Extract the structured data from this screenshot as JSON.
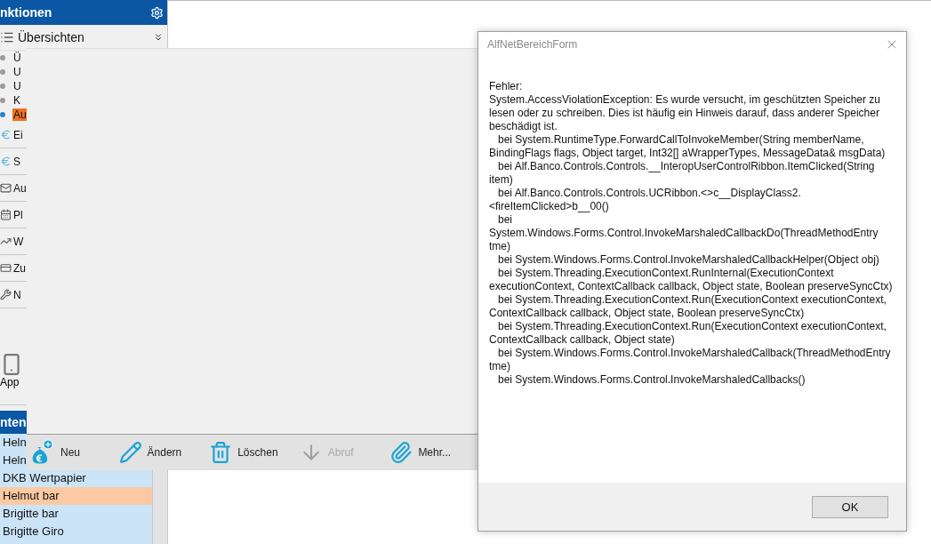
{
  "sidebar": {
    "header": {
      "title": "nktionen"
    },
    "section": {
      "title": "Übersichten"
    },
    "sub_items": [
      {
        "label": "Ü",
        "selected": false
      },
      {
        "label": "U",
        "selected": false
      },
      {
        "label": "U",
        "selected": false
      },
      {
        "label": "K",
        "selected": false
      },
      {
        "label": "Au",
        "selected": true
      }
    ],
    "items": [
      {
        "label": "Ei"
      },
      {
        "label": "S"
      },
      {
        "label": "Au"
      },
      {
        "label": "Pl"
      },
      {
        "label": "W"
      },
      {
        "label": "Zu"
      },
      {
        "label": "N"
      }
    ],
    "app_tile": {
      "label": "App"
    },
    "accounts": {
      "title": "nten",
      "rows": [
        {
          "name": "Heln",
          "selected": false
        },
        {
          "name": "Heln",
          "selected": false
        },
        {
          "name": "DKB Wertpapier",
          "selected": false
        },
        {
          "name": "Helmut bar",
          "selected": true
        },
        {
          "name": "Brigitte bar",
          "selected": false
        },
        {
          "name": "Brigitte Giro",
          "selected": false
        }
      ]
    }
  },
  "toolbar": {
    "buttons": [
      {
        "label": "Neu",
        "disabled": false
      },
      {
        "label": "Ändern",
        "disabled": false
      },
      {
        "label": "Löschen",
        "disabled": false
      },
      {
        "label": "Abruf",
        "disabled": true
      },
      {
        "label": "Mehr...",
        "disabled": false
      }
    ]
  },
  "dialog": {
    "title": "AlfNetBereichForm",
    "heading": "Fehler:",
    "exception": "System.AccessViolationException: Es wurde versucht, im geschützten Speicher zu lesen oder zu schreiben. Dies ist häufig ein Hinweis darauf, dass anderer Speicher beschädigt ist.",
    "stack": [
      "bei System.RuntimeType.ForwardCallToInvokeMember(String memberName, BindingFlags flags, Object target, Int32[] aWrapperTypes, MessageData& msgData)",
      "bei Alf.Banco.Controls.Controls.__InteropUserControlRibbon.ItemClicked(String item)",
      "bei Alf.Banco.Controls.Controls.UCRibbon.<>c__DisplayClass2.<fireItemClicked>b__00()",
      "bei System.Windows.Forms.Control.InvokeMarshaledCallbackDo(ThreadMethodEntry tme)",
      "bei System.Windows.Forms.Control.InvokeMarshaledCallbackHelper(Object obj)",
      "bei System.Threading.ExecutionContext.RunInternal(ExecutionContext executionContext, ContextCallback callback, Object state, Boolean preserveSyncCtx)",
      "bei System.Threading.ExecutionContext.Run(ExecutionContext executionContext, ContextCallback callback, Object state, Boolean preserveSyncCtx)",
      "bei System.Threading.ExecutionContext.Run(ExecutionContext executionContext, ContextCallback callback, Object state)",
      "bei System.Windows.Forms.Control.InvokeMarshaledCallback(ThreadMethodEntry tme)",
      "bei System.Windows.Forms.Control.InvokeMarshaledCallbacks()"
    ],
    "buttons": [
      "OK"
    ]
  }
}
